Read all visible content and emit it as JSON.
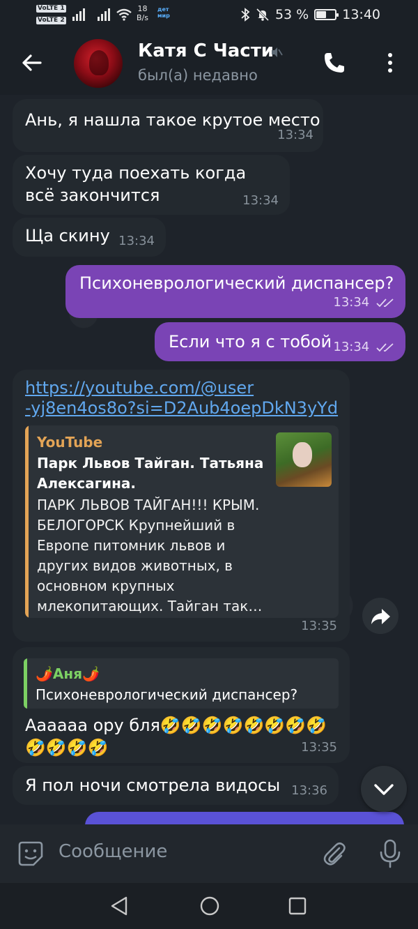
{
  "status_bar": {
    "volte1": "VoLTE 1",
    "volte2": "VoLTE 2",
    "rate_value": "18",
    "rate_unit": "B/s",
    "app_badge": "дет мир",
    "battery": "53 %",
    "battery_level": 0.53,
    "time": "13:40"
  },
  "header": {
    "contact_name": "Катя С Части",
    "status": "был(а) недавно"
  },
  "messages": [
    {
      "text": "Ань, я нашла такое крутое место",
      "time": "13:34"
    },
    {
      "text": "Хочу туда поехать когда всё закончится",
      "time": "13:34"
    },
    {
      "text": "Ща скину",
      "time": "13:34"
    },
    {
      "text": "Психоневрологический диспансер?",
      "time": "13:34"
    },
    {
      "text": "Если что я с тобой",
      "time": "13:34"
    },
    {
      "link_line1": "https://youtube.com/@user",
      "link_line2": "-yj8en4os8o?si=D2Aub4oepDkN3yYd",
      "preview_site": "YouTube",
      "preview_title": "Парк Львов Тайган. Татьяна Алексагина.",
      "preview_description": "ПАРК ЛЬВОВ ТАЙГАН!!! КРЫМ. БЕЛОГОРСК Крупнейший в Европе питомник львов и других видов животных, в основном крупных млекопитающих. Тайган так…",
      "time": "13:35"
    },
    {
      "reply_name": "🌶️Аня🌶️",
      "reply_text": "Психоневрологический диспансер?",
      "text": "Аааааа ору бля🤣🤣🤣🤣🤣🤣🤣🤣🤣🤣🤣🤣",
      "time": "13:35"
    },
    {
      "text": "Я пол ночи смотрела видосы",
      "time": "13:36"
    }
  ],
  "composer": {
    "placeholder": "Сообщение"
  },
  "icons": {
    "back": "arrow-left-icon",
    "mute": "mute-icon",
    "call": "phone-icon",
    "more": "more-vertical-icon",
    "share": "share-icon",
    "scroll_down": "chevron-down-icon",
    "emoji": "sticker-icon",
    "attach": "paperclip-icon",
    "mic": "microphone-icon"
  },
  "colors": {
    "outgoing_bubble": "#7a44b5",
    "incoming_bubble": "#23292f",
    "link": "#61a8ef",
    "preview_accent": "#e3a456",
    "reply_accent": "#7cd063"
  }
}
